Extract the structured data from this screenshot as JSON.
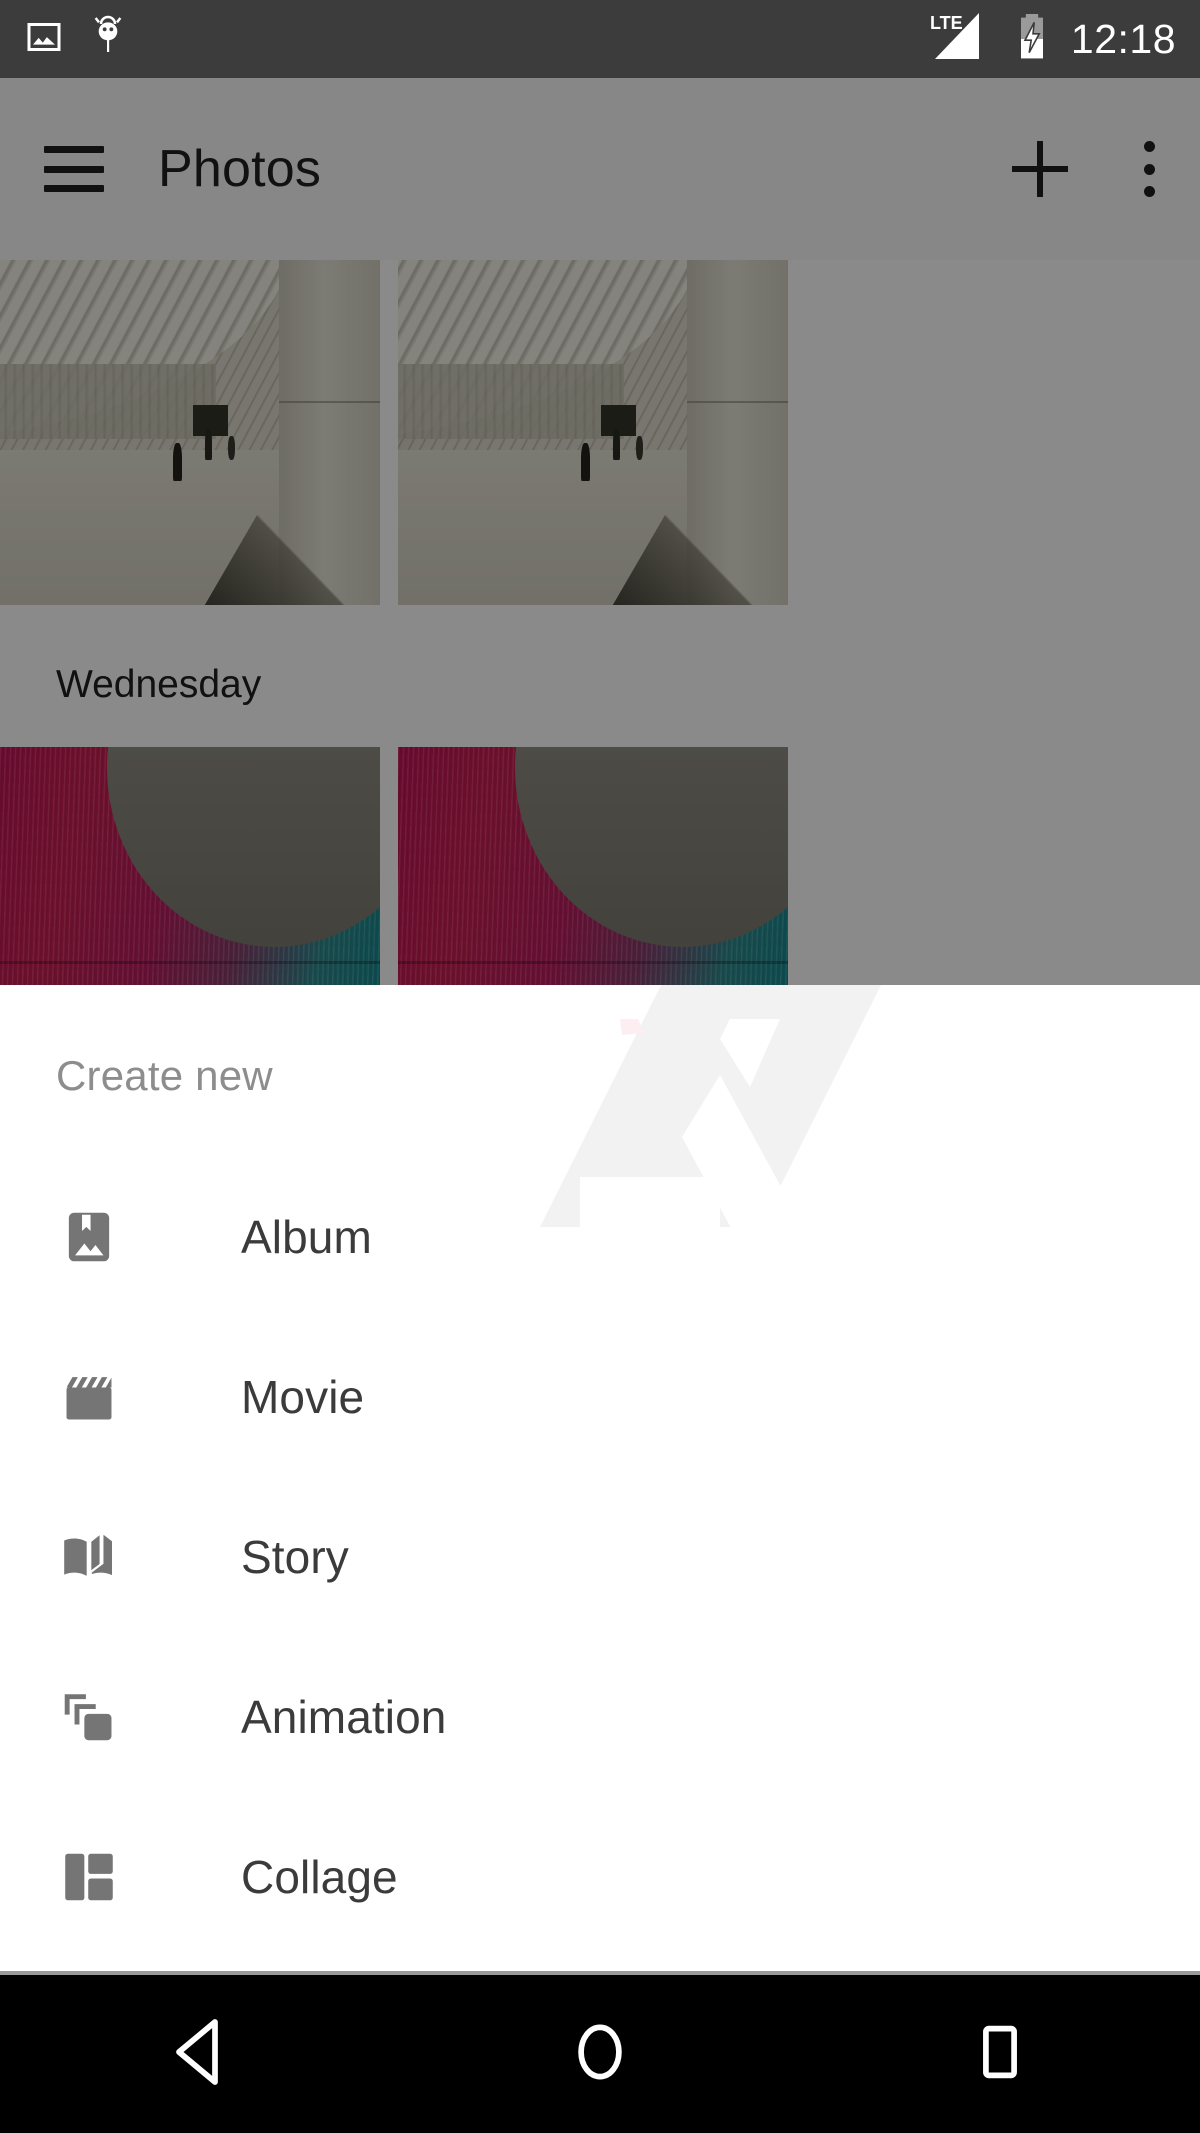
{
  "statusbar": {
    "time": "12:18",
    "left_icons": [
      "screenshot-icon",
      "adb-bug-icon"
    ],
    "right_icons": [
      "lte-signal-icon",
      "battery-charging-icon"
    ],
    "network_label": "LTE",
    "background_color": "#3c3c3c"
  },
  "toolbar": {
    "menu_icon": "hamburger-icon",
    "title": "Photos",
    "add_icon": "plus-icon",
    "overflow_icon": "kebab-menu-icon"
  },
  "photo_grid": {
    "day_label": "Wednesday",
    "rows": [
      {
        "style": "architecture",
        "items": [
          {
            "alt": "white ribbed corridor with walkway"
          },
          {
            "alt": "white ribbed corridor with walkway"
          }
        ]
      },
      {
        "style": "lights",
        "items": [
          {
            "alt": "magenta to teal light installation"
          },
          {
            "alt": "magenta to teal light installation"
          }
        ]
      }
    ]
  },
  "bottom_sheet": {
    "title": "Create new",
    "title_color": "#8d8d8d",
    "background_color": "#ffffff",
    "watermark": "android-police-logo",
    "items": [
      {
        "label": "Album",
        "icon": "album-photo-bookmark-icon"
      },
      {
        "label": "Movie",
        "icon": "movie-clapperboard-icon"
      },
      {
        "label": "Story",
        "icon": "open-book-icon"
      },
      {
        "label": "Animation",
        "icon": "stacked-layers-icon"
      },
      {
        "label": "Collage",
        "icon": "collage-grid-icon"
      }
    ],
    "item_icon_color": "#757575",
    "item_label_color": "#3b3b3b"
  },
  "navbar": {
    "background_color": "#000000",
    "buttons": [
      {
        "name": "back",
        "icon": "back-triangle-icon"
      },
      {
        "name": "home",
        "icon": "home-circle-icon"
      },
      {
        "name": "recents",
        "icon": "recents-square-icon"
      }
    ]
  }
}
